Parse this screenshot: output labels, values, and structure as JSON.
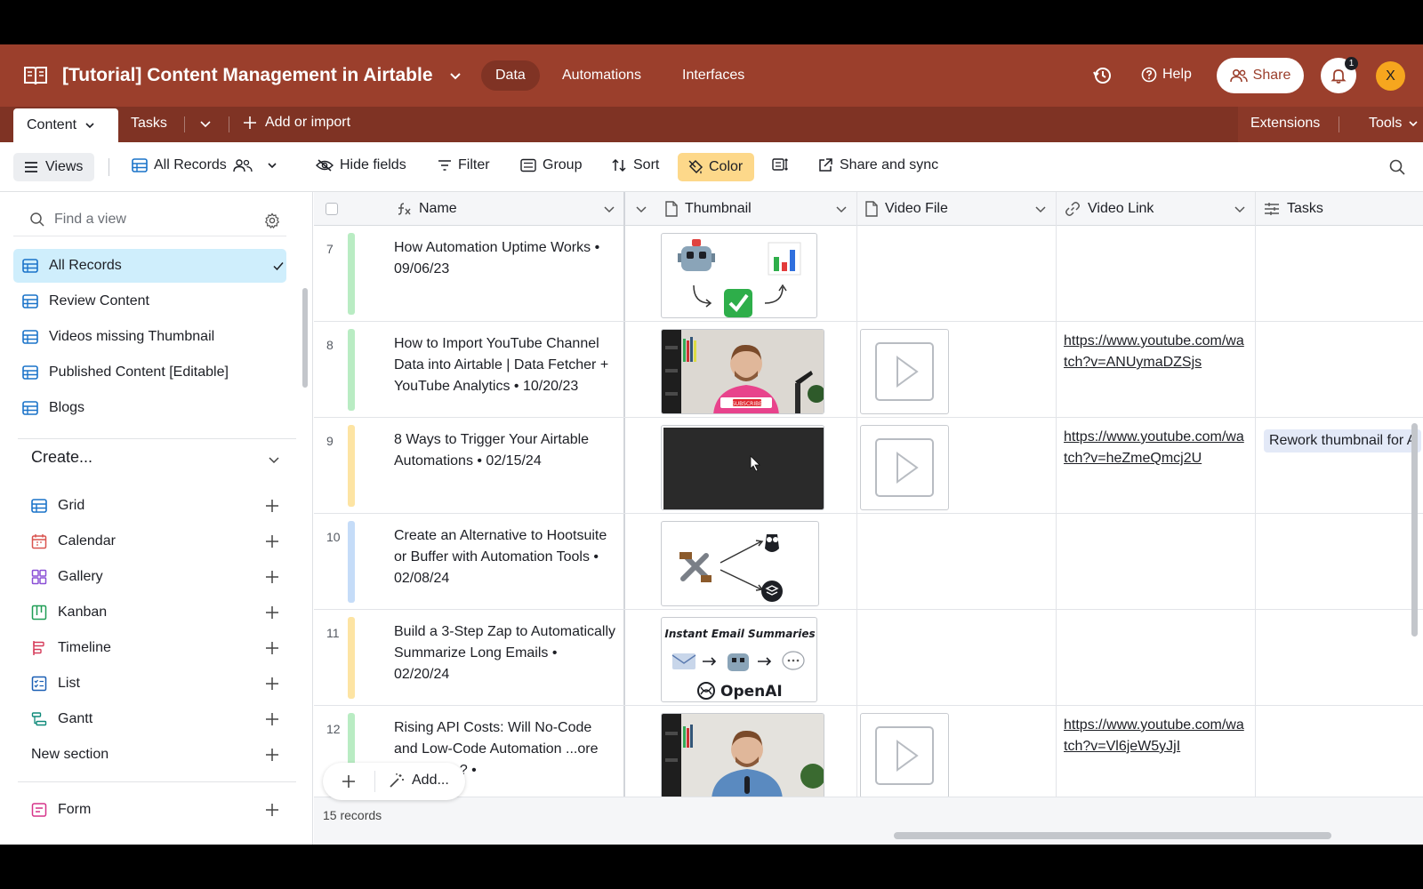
{
  "topbar": {
    "base_title": "[Tutorial] Content Management in Airtable",
    "nav": [
      {
        "label": "Data",
        "active": true
      },
      {
        "label": "Automations",
        "active": false
      },
      {
        "label": "Interfaces",
        "active": false
      }
    ],
    "help_label": "Help",
    "share_label": "Share",
    "notification_count": "1",
    "avatar_initial": "X",
    "colors": {
      "brand": "#9b3f2c",
      "brand_dark": "#7f3324",
      "avatar": "#f6a61e"
    }
  },
  "tablebar": {
    "tabs": [
      {
        "label": "Content",
        "active": true
      },
      {
        "label": "Tasks",
        "active": false
      }
    ],
    "add_label": "Add or import",
    "extensions_label": "Extensions",
    "tools_label": "Tools"
  },
  "viewbar": {
    "views_label": "Views",
    "current_view": "All Records",
    "hide_fields": "Hide fields",
    "filter": "Filter",
    "group": "Group",
    "sort": "Sort",
    "color": "Color",
    "share_sync": "Share and sync"
  },
  "sidebar": {
    "find_placeholder": "Find a view",
    "views": [
      {
        "label": "All Records",
        "active": true
      },
      {
        "label": "Review Content",
        "active": false
      },
      {
        "label": "Videos missing Thumbnail",
        "active": false
      },
      {
        "label": "Published Content [Editable]",
        "active": false
      },
      {
        "label": "Blogs",
        "active": false
      }
    ],
    "create_label": "Create...",
    "create_items": [
      {
        "label": "Grid",
        "icon": "grid-icon",
        "color": "#1a73c9"
      },
      {
        "label": "Calendar",
        "icon": "calendar-icon",
        "color": "#d9534f"
      },
      {
        "label": "Gallery",
        "icon": "gallery-icon",
        "color": "#8a4fd6"
      },
      {
        "label": "Kanban",
        "icon": "kanban-icon",
        "color": "#1f9d55"
      },
      {
        "label": "Timeline",
        "icon": "timeline-icon",
        "color": "#d63c5a"
      },
      {
        "label": "List",
        "icon": "list-icon",
        "color": "#1a5fb4"
      },
      {
        "label": "Gantt",
        "icon": "gantt-icon",
        "color": "#0f8a7a"
      }
    ],
    "new_section_label": "New section",
    "form_label": "Form"
  },
  "grid": {
    "columns": [
      {
        "label": "Name",
        "icon": "formula-icon"
      },
      {
        "label": "Thumbnail",
        "icon": "file-icon"
      },
      {
        "label": "Video File",
        "icon": "file-icon"
      },
      {
        "label": "Video Link",
        "icon": "link-icon"
      },
      {
        "label": "Tasks",
        "icon": "linked-record-icon"
      }
    ],
    "rows": [
      {
        "num": "7",
        "bar_color": "#b9ecc3",
        "name": "How Automation Uptime Works • 09/06/23",
        "thumb": "robot-chart",
        "has_video": false,
        "link": "",
        "task": ""
      },
      {
        "num": "8",
        "bar_color": "#b9ecc3",
        "name": "How to Import YouTube Channel Data into Airtable | Data Fetcher + YouTube Analytics • 10/20/23",
        "thumb": "person-pink",
        "has_video": true,
        "link": "https://www.youtube.com/watch?v=ANUymaDZSjs",
        "task": ""
      },
      {
        "num": "9",
        "bar_color": "#fde4a3",
        "name": "8 Ways to Trigger Your Airtable Automations • 02/15/24",
        "thumb": "dark",
        "has_video": true,
        "link": "https://www.youtube.com/watch?v=heZmeQmcj2U",
        "task": "Rework thumbnail for A"
      },
      {
        "num": "10",
        "bar_color": "#c5dcf8",
        "name": "Create an Alternative to Hootsuite or Buffer with Automation Tools • 02/08/24",
        "thumb": "tools",
        "has_video": false,
        "link": "",
        "task": ""
      },
      {
        "num": "11",
        "bar_color": "#fde4a3",
        "name": "Build a 3-Step Zap to Automatically Summarize Long Emails • 02/20/24",
        "thumb": "openai",
        "has_video": false,
        "link": "",
        "task": ""
      },
      {
        "num": "12",
        "bar_color": "#b9ecc3",
        "name": "Rising API Costs: Will No-Code and Low-Code Automation ...ore Expensive? •",
        "thumb": "person-blue",
        "has_video": true,
        "link": "https://www.youtube.com/watch?v=Vl6jeW5yJjI",
        "task": ""
      }
    ],
    "thumb_texts": {
      "email_title": "Instant Email Summaries",
      "openai": "OpenAI",
      "subscribe": "SUBSCRIBE"
    },
    "add_label": "Add...",
    "record_count": "15 records"
  }
}
